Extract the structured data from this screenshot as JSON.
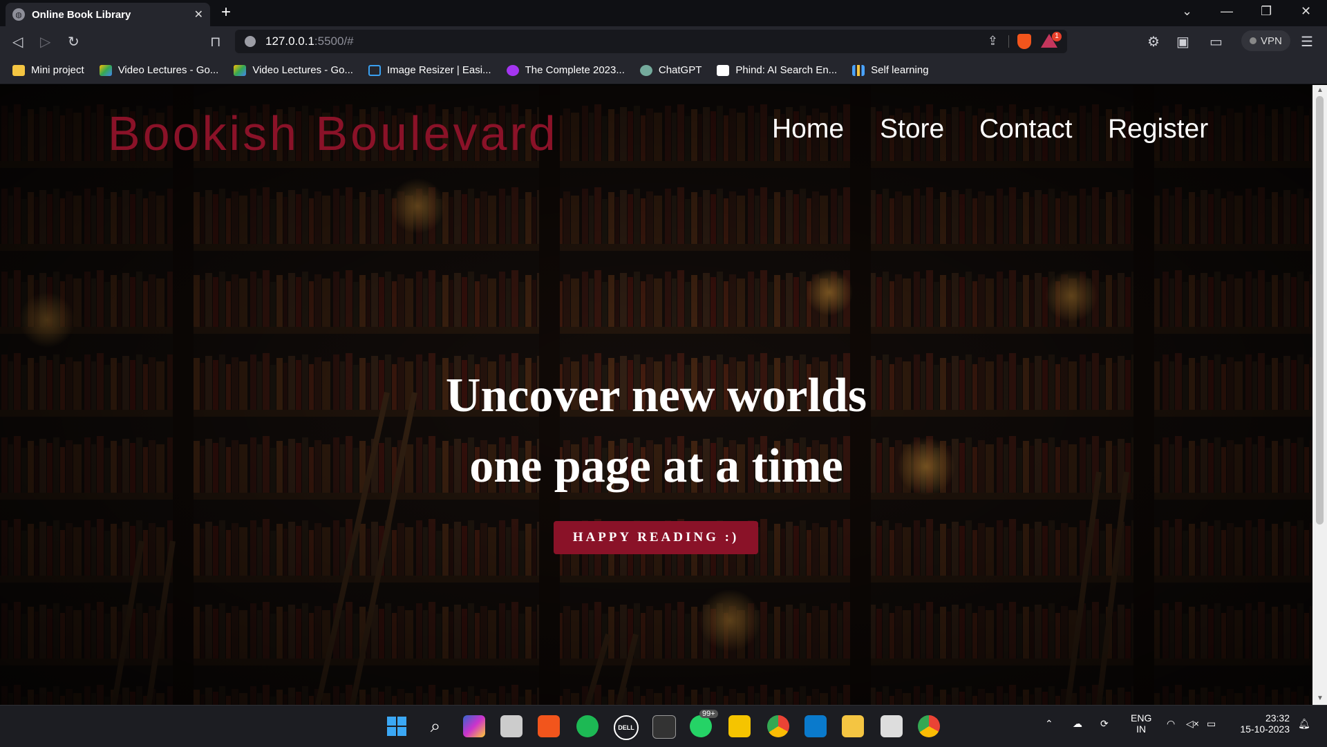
{
  "browser": {
    "tab_title": "Online Book Library",
    "url_host": "127.0.0.1",
    "url_rest": ":5500/#",
    "vpn_label": "VPN",
    "rewards_badge": "1"
  },
  "bookmarks": [
    {
      "label": "Mini project",
      "icon": "folder-icon",
      "color": "#f4c542"
    },
    {
      "label": "Video Lectures - Go...",
      "icon": "drive-icon",
      "color": "#34a853"
    },
    {
      "label": "Video Lectures - Go...",
      "icon": "drive-icon",
      "color": "#4285f4"
    },
    {
      "label": "Image Resizer | Easi...",
      "icon": "resize-icon",
      "color": "#3aa0f0"
    },
    {
      "label": "The Complete 2023...",
      "icon": "udemy-icon",
      "color": "#a435f0"
    },
    {
      "label": "ChatGPT",
      "icon": "chatgpt-icon",
      "color": "#74aa9c"
    },
    {
      "label": "Phind: AI Search En...",
      "icon": "phind-icon",
      "color": "#ffffff"
    },
    {
      "label": "Self learning",
      "icon": "chart-icon",
      "color": "#4aa3ff"
    }
  ],
  "site": {
    "brand": "Bookish Boulevard",
    "nav": [
      "Home",
      "Store",
      "Contact",
      "Register"
    ],
    "hero_line1": "Uncover new worlds",
    "hero_line2": "one page at a time",
    "cta": "HAPPY READING :)",
    "accent_color": "#8a1228"
  },
  "taskbar": {
    "whatsapp_badge": "99+",
    "lang_line1": "ENG",
    "lang_line2": "IN",
    "time": "23:32",
    "date": "15-10-2023"
  }
}
